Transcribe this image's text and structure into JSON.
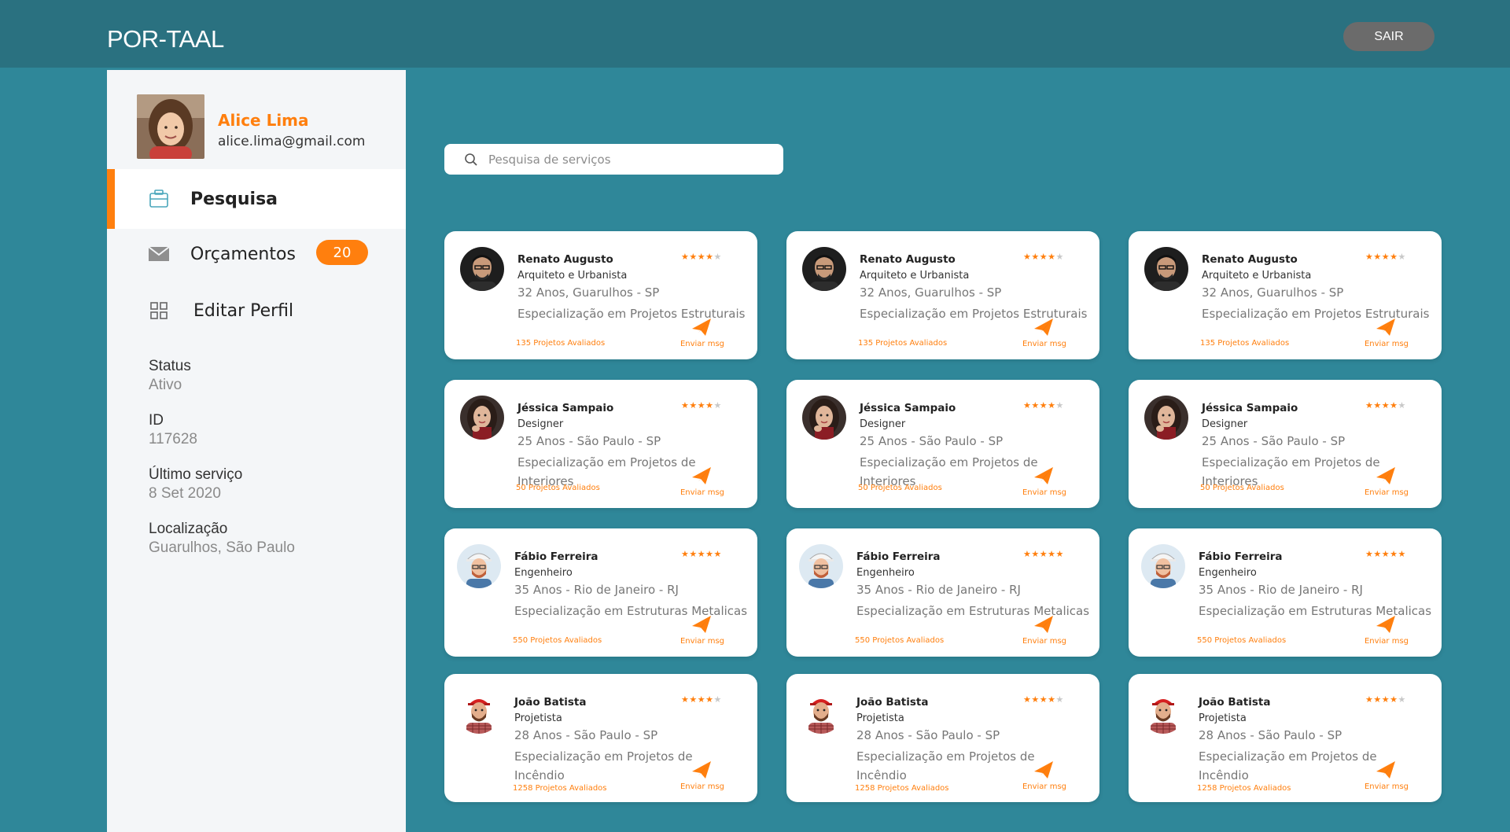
{
  "header": {
    "logo": "POR-TAAL",
    "logout_label": "SAIR"
  },
  "colors": {
    "accent": "#ff7f0e",
    "header_bg": "#2a7180",
    "page_bg": "#2f8799"
  },
  "user": {
    "name": "Alice Lima",
    "email": "alice.lima@gmail.com"
  },
  "sidebar": {
    "nav": [
      {
        "label": "Pesquisa",
        "icon": "briefcase-icon"
      },
      {
        "label": "Orçamentos",
        "icon": "mail-icon",
        "badge": "20"
      },
      {
        "label": "Editar Perfil",
        "icon": "grid-icon"
      }
    ],
    "info": [
      {
        "label": "Status",
        "value": "Ativo"
      },
      {
        "label": "ID",
        "value": "117628"
      },
      {
        "label": "Último serviço",
        "value": "8 Set 2020"
      },
      {
        "label": "Localização",
        "value": "Guarulhos, São Paulo"
      }
    ]
  },
  "search": {
    "placeholder": "Pesquisa de serviços"
  },
  "card_action_label": "Enviar msg",
  "professionals": [
    {
      "name": "Renato Augusto",
      "role": "Arquiteto e Urbanista",
      "age_location": "32 Anos, Guarulhos - SP",
      "specialization": "Especialização em Projetos Estruturais",
      "projects": "135 Projetos Avaliados",
      "rating": 4
    },
    {
      "name": "Jéssica Sampaio",
      "role": "Designer",
      "age_location": "25 Anos - São Paulo - SP",
      "specialization": "Especialização em Projetos de Interiores",
      "projects": "50 Projetos Avaliados",
      "rating": 4
    },
    {
      "name": "Fábio Ferreira",
      "role": "Engenheiro",
      "age_location": "35 Anos - Rio de Janeiro - RJ",
      "specialization": "Especialização em Estruturas Metalicas",
      "projects": "550 Projetos Avaliados",
      "rating": 5
    },
    {
      "name": "João Batista",
      "role": "Projetista",
      "age_location": "28 Anos - São Paulo - SP",
      "specialization": "Especialização em Projetos de Incêndio",
      "projects": "1258 Projetos Avaliados",
      "rating": 4
    }
  ]
}
